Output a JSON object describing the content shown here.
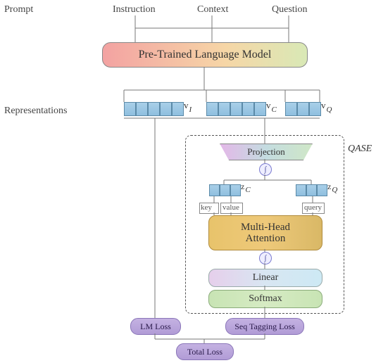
{
  "top_labels": {
    "prompt": "Prompt",
    "instruction": "Instruction",
    "context": "Context",
    "question": "Question"
  },
  "side_labels": {
    "representations": "Representations"
  },
  "blocks": {
    "plm": "Pre-Trained Language Model",
    "projection": "Projection",
    "mha_line1": "Multi-Head",
    "mha_line2": "Attention",
    "linear": "Linear",
    "softmax": "Softmax"
  },
  "rep_symbols": {
    "vI": "v",
    "vI_sub": "I",
    "vC": "v",
    "vC_sub": "C",
    "vQ": "v",
    "vQ_sub": "Q",
    "zC": "z",
    "zC_sub": "C",
    "zQ": "z",
    "zQ_sub": "Q"
  },
  "attn_labels": {
    "key": "key",
    "value": "value",
    "query": "query"
  },
  "losses": {
    "lm": "LM Loss",
    "seq": "Seq Tagging Loss",
    "total": "Total Loss"
  },
  "qase": "QASE",
  "activation_glyph": "∫"
}
